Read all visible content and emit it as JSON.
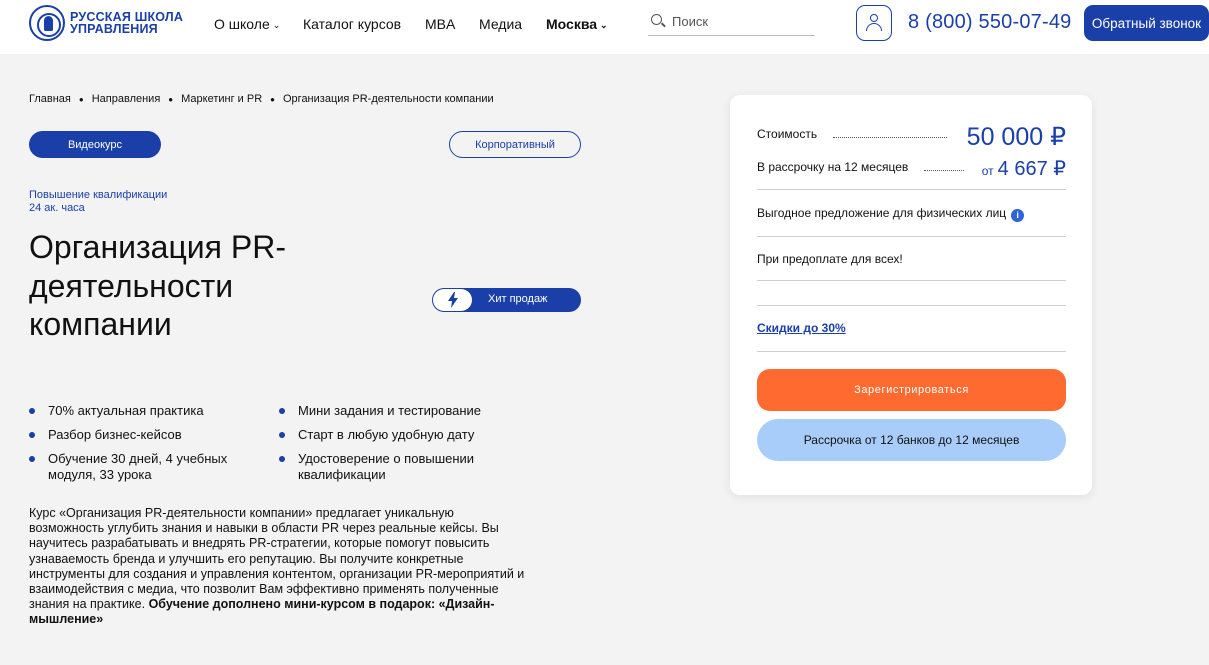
{
  "header": {
    "logo_line1": "РУССКАЯ ШКОЛА",
    "logo_line2": "УПРАВЛЕНИЯ",
    "nav": [
      {
        "label": "О школе",
        "has_dropdown": true
      },
      {
        "label": "Каталог курсов",
        "has_dropdown": false
      },
      {
        "label": "MBA",
        "has_dropdown": false
      },
      {
        "label": "Медиа",
        "has_dropdown": false
      },
      {
        "label": "Москва",
        "has_dropdown": true
      }
    ],
    "search_placeholder": "Поиск",
    "phone": "8 (800) 550-07-49",
    "callback_label": "Обратный звонок"
  },
  "breadcrumb": [
    "Главная",
    "Направления",
    "Маркетинг и PR",
    "Организация PR-деятельности компании"
  ],
  "course": {
    "format_label": "Видеокурс",
    "corporate_label": "Корпоративный",
    "type": "Повышение квалификации",
    "hours": "24 ак. часа",
    "title": "Организация PR-деятельности компании",
    "badge": "Хит продаж",
    "features": [
      "70% актуальная практика",
      "Мини задания и тестирование",
      "Разбор бизнес-кейсов",
      "Старт в любую удобную дату",
      "Обучение 30 дней, 4 учебных модуля, 33 урока",
      "Удостоверение о повышении квалификации"
    ],
    "description": "Курс «Организация PR-деятельности компании» предлагает уникальную возможность углубить знания и навыки в области PR через реальные кейсы. Вы научитесь разрабатывать и внедрять PR-стратегии, которые помогут повысить узнаваемость бренда и улучшить его репутацию. Вы получите конкретные инструменты для создания и управления контентом, организации PR-мероприятий и взаимодействия с медиа, что позволит Вам эффективно применять полученные знания на практике.",
    "description_bold": "Обучение дополнено мини-курсом в подарок: «Дизайн-мышление»"
  },
  "pricing": {
    "cost_label": "Стоимость",
    "cost_value": "50 000 ₽",
    "installment_label": "В рассрочку на 12 месяцев",
    "installment_prefix": "от",
    "installment_value": "4 667 ₽",
    "offer_label": "Выгодное предложение для физических лиц",
    "prepay_label": "При предоплате для всех!",
    "discount_label": "Скидки до 30%",
    "register_label": "Зарегистрироваться",
    "installment_button": "Рассрочка от 12 банков до 12 месяцев"
  },
  "colors": {
    "brand_blue": "#1a3fa8",
    "accent_orange": "#ff6a30",
    "light_blue": "#a9cdfa",
    "background": "#f3f3f3"
  }
}
